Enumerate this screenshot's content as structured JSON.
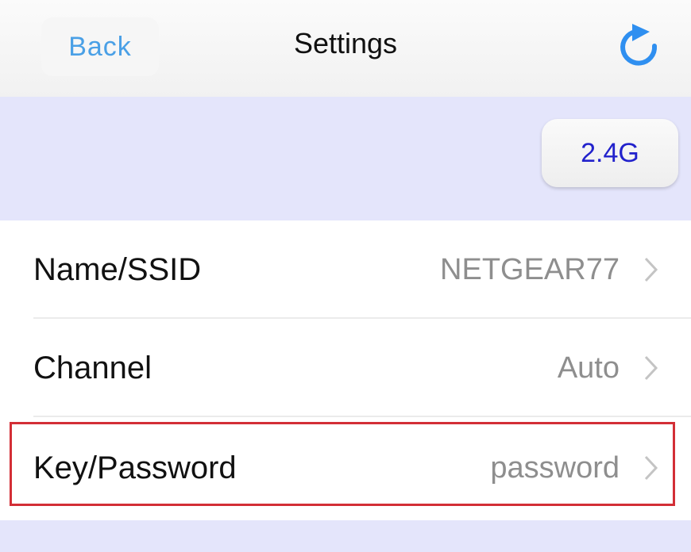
{
  "navbar": {
    "back_label": "Back",
    "title": "Settings",
    "refresh_icon": "refresh-icon",
    "accent_color": "#2f8ff0"
  },
  "band": {
    "selected": "2.4G",
    "background": "#e4e5fb"
  },
  "settings": [
    {
      "label": "Name/SSID",
      "value": "NETGEAR77"
    },
    {
      "label": "Channel",
      "value": "Auto"
    },
    {
      "label": "Key/Password",
      "value": "password",
      "highlighted": true
    }
  ],
  "highlight_color": "#d32f36"
}
